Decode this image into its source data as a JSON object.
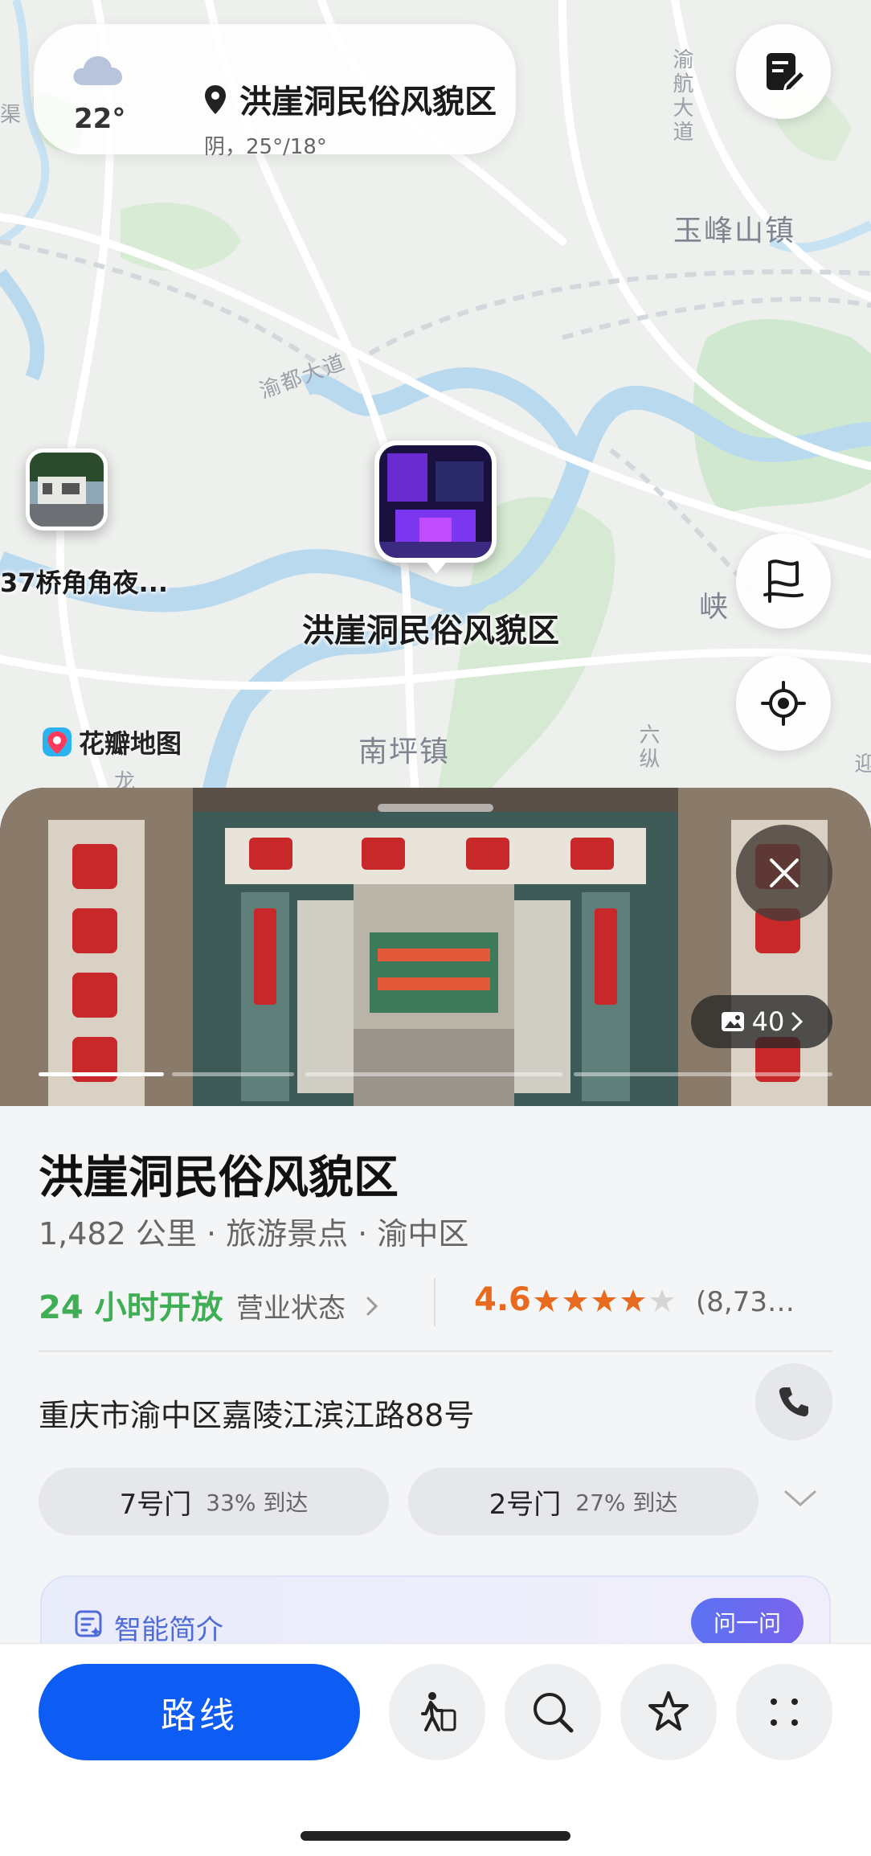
{
  "weather": {
    "temp": "22°",
    "place": "洪崖洞民俗风貌区",
    "condition": "阴，25°/18°"
  },
  "map": {
    "labels": {
      "yufeng": "玉峰山镇",
      "yudu": "渝都大道",
      "nanping": "南坪镇",
      "xia": "峡",
      "yuhang": "渝航大道",
      "liuzong": "六纵",
      "jin": "迎",
      "long": "龙",
      "left_edge": "渠"
    },
    "poi_main_label": "洪崖洞民俗风貌区",
    "poi_side_label": "37桥角角夜...",
    "brand": "花瓣地图"
  },
  "photo": {
    "count": "40"
  },
  "place": {
    "name": "洪崖洞民俗风貌区",
    "meta": "1,482 公里 · 旅游景点 · 渝中区",
    "hours": "24 小时开放",
    "status_label": "营业状态",
    "rating": "4.6",
    "reviews": "(8,73…",
    "address": "重庆市渝中区嘉陵江滨江路88号",
    "gates": [
      {
        "name": "7号门",
        "pct": "33% 到达"
      },
      {
        "name": "2号门",
        "pct": "27% 到达"
      }
    ],
    "ai_label": "智能简介",
    "ask_label": "问一问"
  },
  "bottom": {
    "route_label": "路线"
  },
  "colors": {
    "accent": "#0d5df5",
    "open": "#3fae54",
    "rating": "#e86a1e"
  }
}
